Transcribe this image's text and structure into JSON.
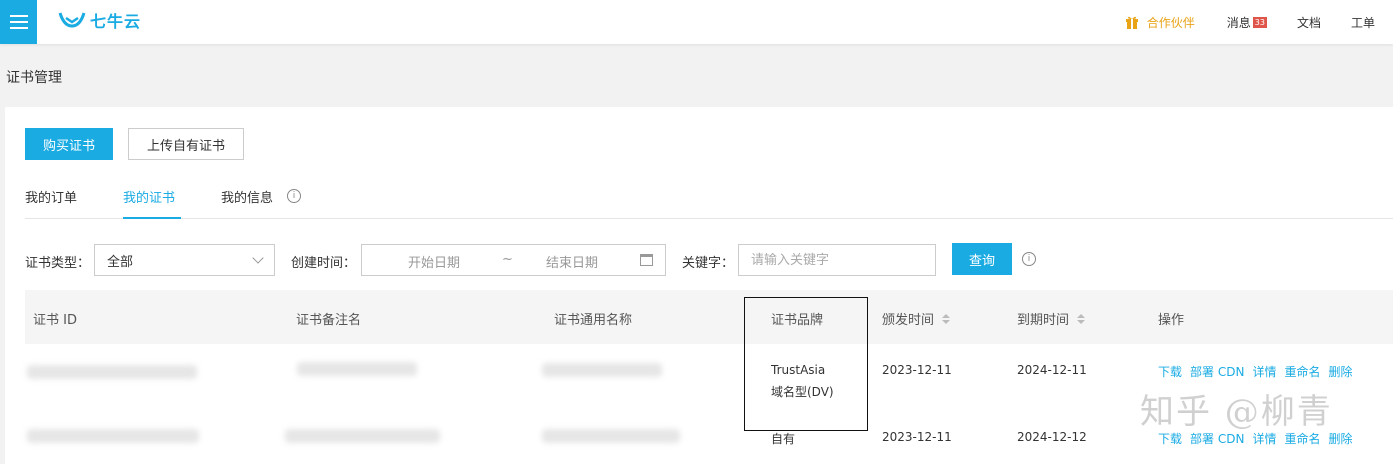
{
  "topbar": {
    "logo_text": "七牛云",
    "partner_label": "合作伙伴",
    "message_label": "消息",
    "message_count": "33",
    "docs_label": "文档",
    "ticket_label": "工单"
  },
  "page": {
    "title": "证书管理"
  },
  "toolbar": {
    "buy_label": "购买证书",
    "upload_label": "上传自有证书"
  },
  "tabs": [
    {
      "label": "我的订单",
      "active": false
    },
    {
      "label": "我的证书",
      "active": true
    },
    {
      "label": "我的信息",
      "active": false
    }
  ],
  "filters": {
    "type_label": "证书类型：",
    "type_value": "全部",
    "created_label": "创建时间：",
    "start_placeholder": "开始日期",
    "range_sep": "~",
    "end_placeholder": "结束日期",
    "keyword_label": "关键字：",
    "keyword_placeholder": "请输入关键字",
    "query_label": "查询"
  },
  "table": {
    "columns": [
      "证书 ID",
      "证书备注名",
      "证书通用名称",
      "证书品牌",
      "颁发时间",
      "到期时间",
      "操作"
    ],
    "rows": [
      {
        "brand_line1": "TrustAsia",
        "brand_line2": "域名型(DV)",
        "issued": "2023-12-11",
        "expires": "2024-12-11"
      },
      {
        "brand_line1": "自有",
        "brand_line2": "",
        "issued": "2023-12-11",
        "expires": "2024-12-12"
      }
    ],
    "actions": [
      "下载",
      "部署 CDN",
      "详情",
      "重命名",
      "删除"
    ]
  },
  "watermark": "知乎 @柳青",
  "colors": {
    "accent": "#1aabe3",
    "partner": "#e8a317",
    "badge": "#e0554a"
  }
}
